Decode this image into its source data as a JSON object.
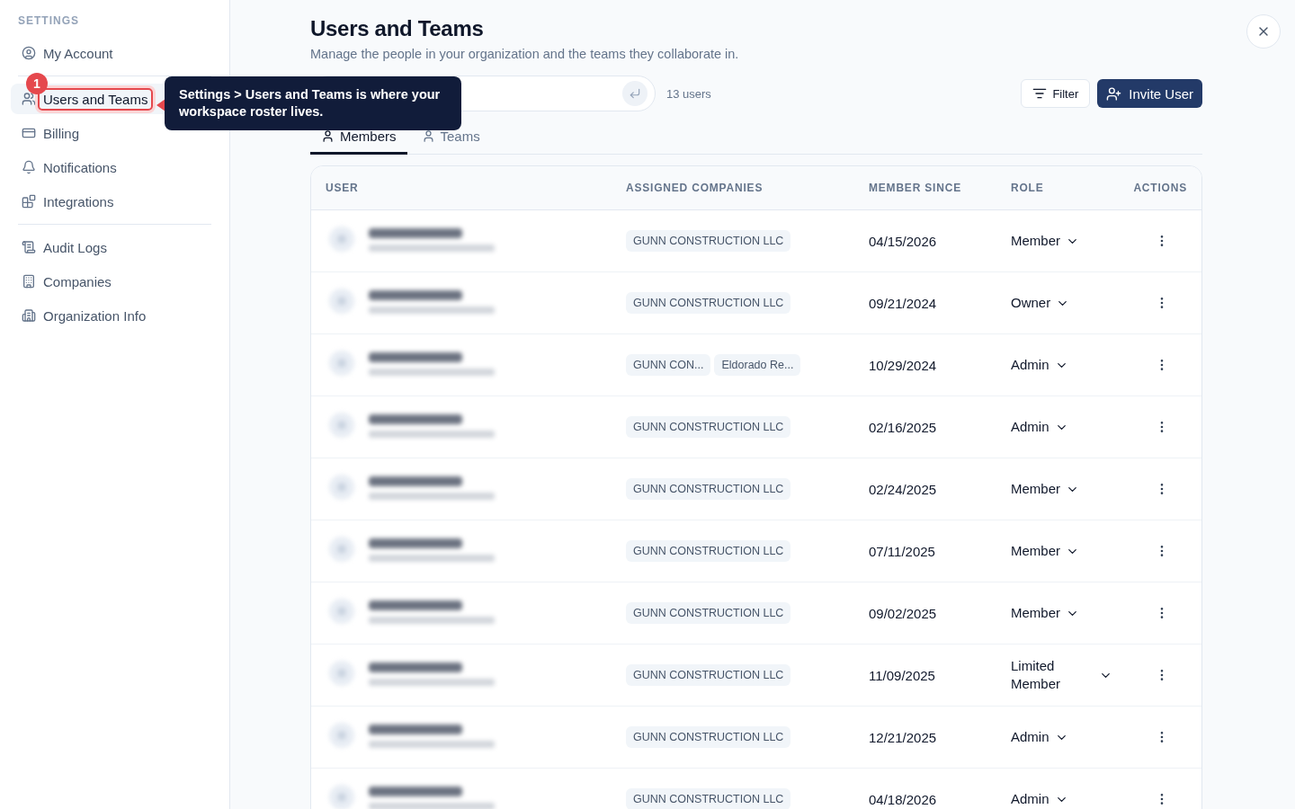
{
  "sidebar": {
    "heading": "SETTINGS",
    "groups": [
      [
        {
          "label": "My Account",
          "selected": false,
          "highlighted": false
        }
      ],
      [
        {
          "label": "Users and Teams",
          "selected": true,
          "highlighted": true
        },
        {
          "label": "Billing",
          "selected": false,
          "highlighted": false
        },
        {
          "label": "Notifications",
          "selected": false,
          "highlighted": false
        },
        {
          "label": "Integrations",
          "selected": false,
          "highlighted": false
        }
      ],
      [
        {
          "label": "Audit Logs",
          "selected": false,
          "highlighted": false
        },
        {
          "label": "Companies",
          "selected": false,
          "highlighted": false
        },
        {
          "label": "Organization Info",
          "selected": false,
          "highlighted": false
        }
      ]
    ]
  },
  "tour": {
    "step": "1",
    "text": "Settings > Users and Teams is where your workspace roster lives."
  },
  "page": {
    "title": "Users and Teams",
    "subtitle": "Manage the people in your organization and the teams they collaborate in."
  },
  "toolbar": {
    "count": "13 users",
    "filter": "Filter",
    "invite": "Invite User"
  },
  "tabs": [
    {
      "label": "Members",
      "selected": true
    },
    {
      "label": "Teams",
      "selected": false
    }
  ],
  "table": {
    "columns": [
      "USER",
      "ASSIGNED COMPANIES",
      "MEMBER SINCE",
      "ROLE",
      "ACTIONS"
    ],
    "rows": [
      {
        "redacted": true,
        "companies": [
          "GUNN CONSTRUCTION LLC"
        ],
        "since": "04/15/2026",
        "role": "Member"
      },
      {
        "redacted": true,
        "companies": [
          "GUNN CONSTRUCTION LLC"
        ],
        "since": "09/21/2024",
        "role": "Owner"
      },
      {
        "redacted": true,
        "companies": [
          "GUNN CON...",
          "Eldorado Re..."
        ],
        "since": "10/29/2024",
        "role": "Admin"
      },
      {
        "redacted": true,
        "companies": [
          "GUNN CONSTRUCTION LLC"
        ],
        "since": "02/16/2025",
        "role": "Admin"
      },
      {
        "redacted": true,
        "companies": [
          "GUNN CONSTRUCTION LLC"
        ],
        "since": "02/24/2025",
        "role": "Member"
      },
      {
        "redacted": true,
        "companies": [
          "GUNN CONSTRUCTION LLC"
        ],
        "since": "07/11/2025",
        "role": "Member"
      },
      {
        "redacted": true,
        "companies": [
          "GUNN CONSTRUCTION LLC"
        ],
        "since": "09/02/2025",
        "role": "Member"
      },
      {
        "redacted": true,
        "companies": [
          "GUNN CONSTRUCTION LLC"
        ],
        "since": "11/09/2025",
        "role": "Limited Member"
      },
      {
        "redacted": true,
        "companies": [
          "GUNN CONSTRUCTION LLC"
        ],
        "since": "12/21/2025",
        "role": "Admin"
      },
      {
        "redacted": true,
        "companies": [
          "GUNN CONSTRUCTION LLC"
        ],
        "since": "04/18/2026",
        "role": "Admin"
      }
    ]
  }
}
